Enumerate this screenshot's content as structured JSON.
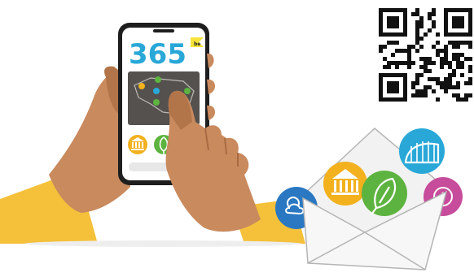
{
  "app": {
    "logo_text": "365",
    "logo_badge": "be",
    "category_buttons": [
      {
        "name": "heritage-category-button",
        "icon": "museum-icon",
        "color": "#F2B11D"
      },
      {
        "name": "nature-category-button",
        "icon": "leaf-icon",
        "color": "#5DB33F"
      },
      {
        "name": "info-category-button",
        "icon": "pin-icon",
        "color": "#29A8D8"
      }
    ],
    "map": {
      "background": "#54514E",
      "dot_colors": [
        "#F2B11D",
        "#5DB33F",
        "#29A8D8",
        "#5DB33F",
        "#5DB33F"
      ]
    }
  },
  "envelope_badges": [
    {
      "name": "weather-badge",
      "icon": "sun-cloud-icon",
      "color": "#2A78C2"
    },
    {
      "name": "heritage-badge",
      "icon": "museum-icon",
      "color": "#F2B11D"
    },
    {
      "name": "nature-badge",
      "icon": "leaf-icon",
      "color": "#5DB33F"
    },
    {
      "name": "bridge-badge",
      "icon": "bridge-icon",
      "color": "#29A8D8"
    },
    {
      "name": "info-badge",
      "icon": "info-icon",
      "color": "#C74C9B"
    }
  ],
  "colors": {
    "skin": "#C98A5E",
    "skin_shadow": "#A96B43",
    "sleeve": "#F5C13B",
    "envelope": "#F2F2F2",
    "envelope_outline": "#B5B5B5"
  }
}
